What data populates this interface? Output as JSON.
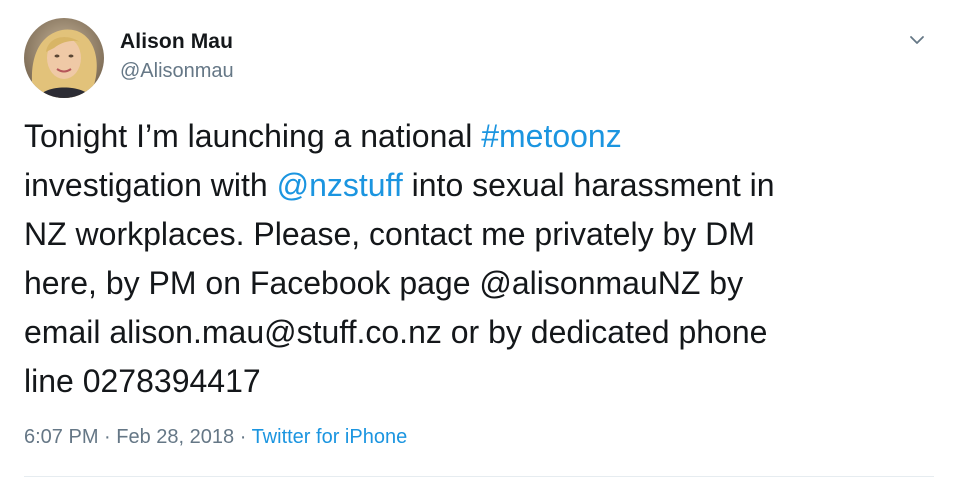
{
  "author": {
    "display_name": "Alison Mau",
    "handle": "@Alisonmau",
    "avatar_icon": "profile-photo"
  },
  "tweet": {
    "lines": [
      [
        {
          "text": "Tonight I’m launching a national ",
          "kind": "text"
        },
        {
          "text": "#metoonz",
          "kind": "hashtag"
        }
      ],
      [
        {
          "text": "investigation with ",
          "kind": "text"
        },
        {
          "text": "@nzstuff",
          "kind": "mention"
        },
        {
          "text": " into sexual harassment in",
          "kind": "text"
        }
      ],
      [
        {
          "text": "NZ workplaces. Please, contact me privately by DM",
          "kind": "text"
        }
      ],
      [
        {
          "text": "here, by PM on Facebook page @alisonmauNZ by",
          "kind": "text"
        }
      ],
      [
        {
          "text": "email alison.mau@stuff.co.nz or by dedicated phone",
          "kind": "text"
        }
      ],
      [
        {
          "text": "line 0278394417",
          "kind": "text"
        }
      ]
    ]
  },
  "meta": {
    "time": "6:07 PM",
    "separator": " · ",
    "date": "Feb 28, 2018",
    "source": "Twitter for iPhone"
  },
  "menu": {
    "icon": "chevron-down-icon"
  },
  "colors": {
    "link": "#1b95e0",
    "secondary_text": "#657786",
    "primary_text": "#14171a",
    "divider": "#e6ecf0"
  }
}
